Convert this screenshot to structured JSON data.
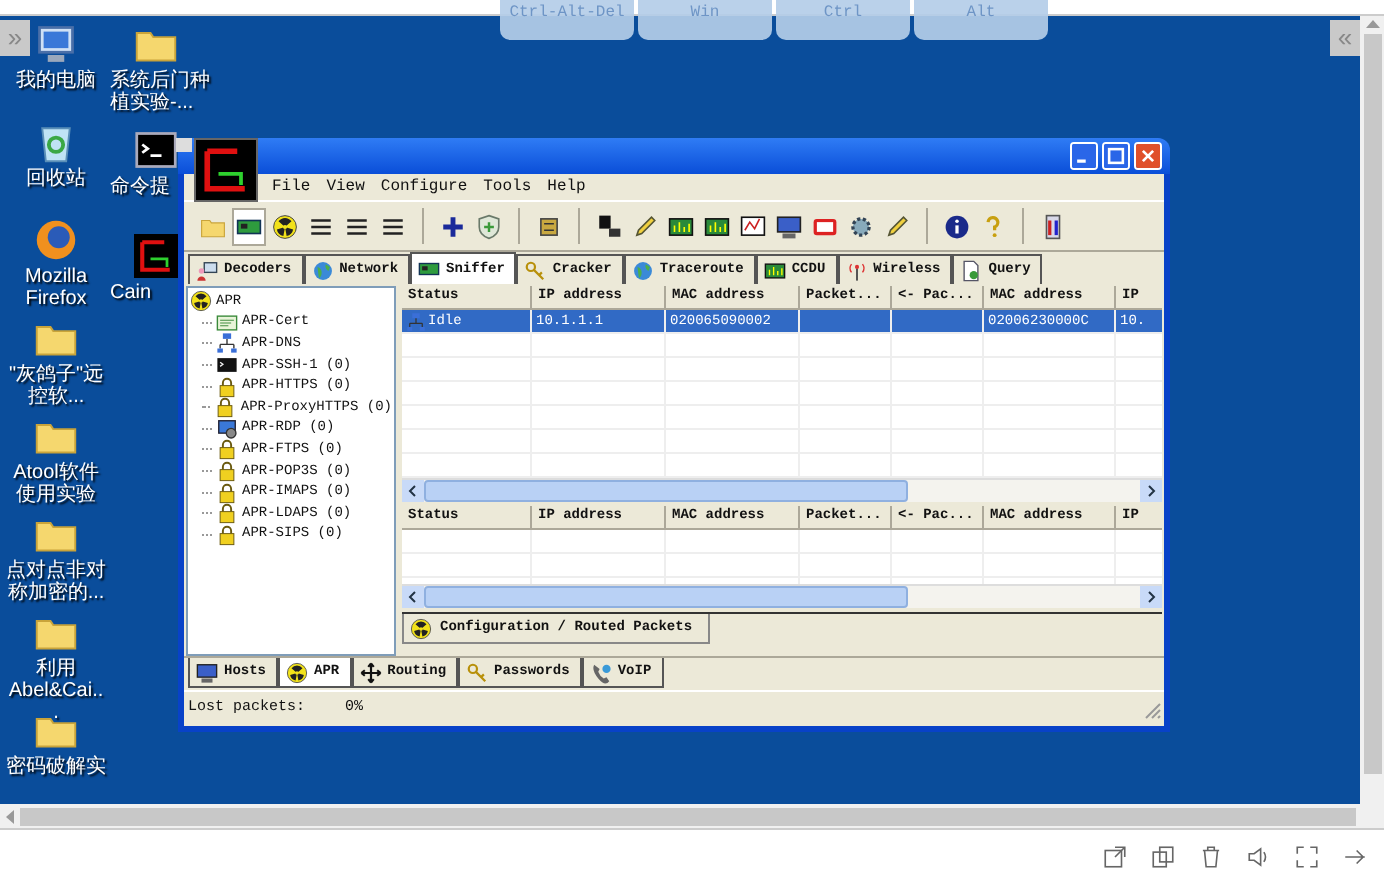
{
  "remote_keys": [
    "Ctrl-Alt-Del",
    "Win",
    "Ctrl",
    "Alt"
  ],
  "left_toggle": "»",
  "right_toggle": "«",
  "desktop_column_1": [
    {
      "kind": "computer",
      "label": "我的电脑"
    },
    {
      "kind": "recycle",
      "label": "回收站"
    },
    {
      "kind": "firefox",
      "label": "Mozilla Firefox"
    },
    {
      "kind": "folder",
      "label": "\"灰鸽子\"远控软..."
    },
    {
      "kind": "folder",
      "label": "Atool软件使用实验"
    },
    {
      "kind": "folder",
      "label": "点对点非对称加密的..."
    },
    {
      "kind": "folder",
      "label": "利用Abel&Cai..."
    },
    {
      "kind": "folder",
      "label": "密码破解实"
    }
  ],
  "desktop_column_2": [
    {
      "kind": "folder",
      "label": "系统后门种植实验-..."
    },
    {
      "kind": "cmd",
      "label": "命令提"
    },
    {
      "kind": "cain",
      "label": "Cain"
    }
  ],
  "window": {
    "menu": [
      "File",
      "View",
      "Configure",
      "Tools",
      "Help"
    ],
    "toolbar": [
      [
        {
          "kind": "folder",
          "pressed": false
        },
        {
          "kind": "netcard",
          "pressed": true
        },
        {
          "kind": "radiation",
          "pressed": false
        },
        {
          "kind": "textlines",
          "pressed": false
        },
        {
          "kind": "textlines",
          "pressed": false
        },
        {
          "kind": "textlines",
          "pressed": false
        }
      ],
      [
        {
          "kind": "plus",
          "pressed": false
        },
        {
          "kind": "shield",
          "pressed": false
        }
      ],
      [
        {
          "kind": "chip",
          "pressed": false
        }
      ],
      [
        {
          "kind": "blocks",
          "pressed": false
        },
        {
          "kind": "pencil",
          "pressed": false
        },
        {
          "kind": "chartboard",
          "pressed": false
        },
        {
          "kind": "chartboard",
          "pressed": false
        },
        {
          "kind": "linechart",
          "pressed": false
        },
        {
          "kind": "monitor",
          "pressed": false
        },
        {
          "kind": "card",
          "pressed": false
        },
        {
          "kind": "gear",
          "pressed": false
        },
        {
          "kind": "pencil",
          "pressed": false
        }
      ],
      [
        {
          "kind": "info",
          "pressed": false
        },
        {
          "kind": "help",
          "pressed": false
        }
      ],
      [
        {
          "kind": "door",
          "pressed": false
        }
      ]
    ],
    "tabs": [
      {
        "label": "Decoders",
        "kind": "workstation",
        "selected": false
      },
      {
        "label": "Network",
        "kind": "globe",
        "selected": false
      },
      {
        "label": "Sniffer",
        "kind": "netcard",
        "selected": true
      },
      {
        "label": "Cracker",
        "kind": "key",
        "selected": false
      },
      {
        "label": "Traceroute",
        "kind": "globe",
        "selected": false
      },
      {
        "label": "CCDU",
        "kind": "chartboard",
        "selected": false
      },
      {
        "label": "Wireless",
        "kind": "antenna",
        "selected": false
      },
      {
        "label": "Query",
        "kind": "document",
        "selected": false
      }
    ],
    "tree": {
      "label": "APR",
      "kind": "radiation",
      "children": [
        {
          "label": "APR-Cert",
          "kind": "cert"
        },
        {
          "label": "APR-DNS",
          "kind": "network"
        },
        {
          "label": "APR-SSH-1 (0)",
          "kind": "terminal"
        },
        {
          "label": "APR-HTTPS (0)",
          "kind": "lock"
        },
        {
          "label": "APR-ProxyHTTPS (0)",
          "kind": "lock"
        },
        {
          "label": "APR-RDP (0)",
          "kind": "rdp"
        },
        {
          "label": "APR-FTPS (0)",
          "kind": "lock"
        },
        {
          "label": "APR-POP3S (0)",
          "kind": "lock"
        },
        {
          "label": "APR-IMAPS (0)",
          "kind": "lock"
        },
        {
          "label": "APR-LDAPS (0)",
          "kind": "lock"
        },
        {
          "label": "APR-SIPS (0)",
          "kind": "lock"
        }
      ]
    },
    "hosts_table": {
      "columns": [
        "Status",
        "IP address",
        "MAC address",
        "Packet...",
        "<- Pac...",
        "MAC address",
        "IP"
      ],
      "rows": [
        {
          "cells": [
            "Idle",
            "10.1.1.1",
            "020065090002",
            null,
            null,
            "02006230000C",
            "10."
          ],
          "selected": true
        }
      ]
    },
    "routed_table": {
      "columns": [
        "Status",
        "IP address",
        "MAC address",
        "Packet...",
        "<- Pac...",
        "MAC address",
        "IP"
      ]
    },
    "sub_tab": "Configuration / Routed Packets",
    "bottom_tabs": [
      {
        "label": "Hosts",
        "kind": "monitor",
        "selected": false
      },
      {
        "label": "APR",
        "kind": "radiation",
        "selected": true
      },
      {
        "label": "Routing",
        "kind": "arrows",
        "selected": false
      },
      {
        "label": "Passwords",
        "kind": "key",
        "selected": false
      },
      {
        "label": "VoIP",
        "kind": "phone",
        "selected": false
      }
    ],
    "status": {
      "label": "Lost packets:",
      "value": "0%"
    }
  }
}
